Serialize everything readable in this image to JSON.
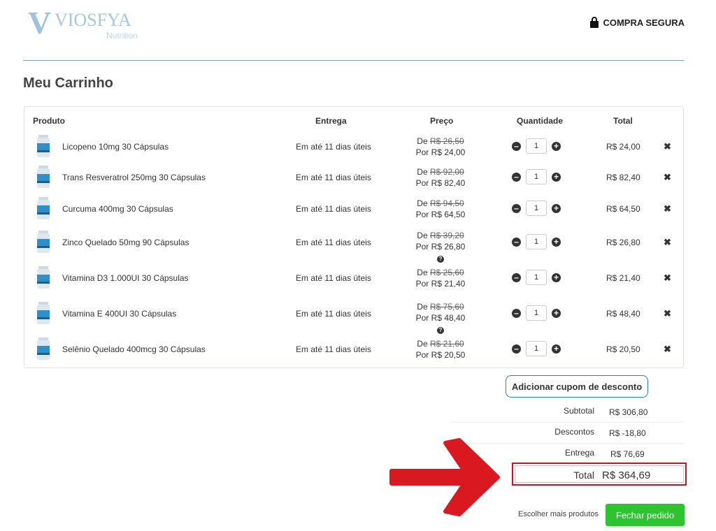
{
  "header": {
    "logo_text": "VIOSFYA",
    "logo_sub": "Nutrition",
    "secure_label": "COMPRA SEGURA"
  },
  "page_title": "Meu Carrinho",
  "table": {
    "headers": {
      "product": "Produto",
      "delivery": "Entrega",
      "price": "Preço",
      "quantity": "Quantidade",
      "total": "Total"
    },
    "rows": [
      {
        "name": "Licopeno 10mg 30 Cápsulas",
        "delivery": "Em até 11 dias úteis",
        "price_old": "R$ 26,50",
        "price_new": "R$ 24,00",
        "qty": "1",
        "total": "R$ 24,00",
        "help": false
      },
      {
        "name": "Trans Resveratrol 250mg 30 Cápsulas",
        "delivery": "Em até 11 dias úteis",
        "price_old": "R$ 92,00",
        "price_new": "R$ 82,40",
        "qty": "1",
        "total": "R$ 82,40",
        "help": false
      },
      {
        "name": "Curcuma 400mg 30 Cápsulas",
        "delivery": "Em até 11 dias úteis",
        "price_old": "R$ 94,50",
        "price_new": "R$ 64,50",
        "qty": "1",
        "total": "R$ 64,50",
        "help": false
      },
      {
        "name": "Zinco Quelado 50mg 90 Cápsulas",
        "delivery": "Em até 11 dias úteis",
        "price_old": "R$ 39,20",
        "price_new": "R$ 26,80",
        "qty": "1",
        "total": "R$ 26,80",
        "help": true
      },
      {
        "name": "Vitamina D3 1.000UI 30 Cápsulas",
        "delivery": "Em até 11 dias úteis",
        "price_old": "R$ 25,60",
        "price_new": "R$ 21,40",
        "qty": "1",
        "total": "R$ 21,40",
        "help": false
      },
      {
        "name": "Vitamina E 400UI  30 Cápsulas",
        "delivery": "Em até 11 dias úteis",
        "price_old": "R$ 75,60",
        "price_new": "R$ 48,40",
        "qty": "1",
        "total": "R$ 48,40",
        "help": true
      },
      {
        "name": "Selênio Quelado 400mcg 30 Cápsulas",
        "delivery": "Em até 11 dias úteis",
        "price_old": "R$ 21,60",
        "price_new": "R$ 20,50",
        "qty": "1",
        "total": "R$ 20,50",
        "help": false
      }
    ],
    "price_prefix_old": "De",
    "price_prefix_new": "Por",
    "remove_icon": "close-icon"
  },
  "coupon_label": "Adicionar cupom de desconto",
  "summary": {
    "subtotal_label": "Subtotal",
    "subtotal_value": "R$ 306,80",
    "discount_label": "Descontos",
    "discount_value": "R$ -18,80",
    "shipping_label": "Entrega",
    "shipping_value": "R$ 76,69",
    "total_label": "Total",
    "total_value": "R$ 364,69"
  },
  "actions": {
    "more_products": "Escolher mais produtos",
    "checkout": "Fechar pedido"
  },
  "colors": {
    "accent_blue": "#2b7fbf",
    "checkout_green": "#2ec431",
    "highlight_red": "#c0161c",
    "arrow_red": "#d9191f"
  }
}
